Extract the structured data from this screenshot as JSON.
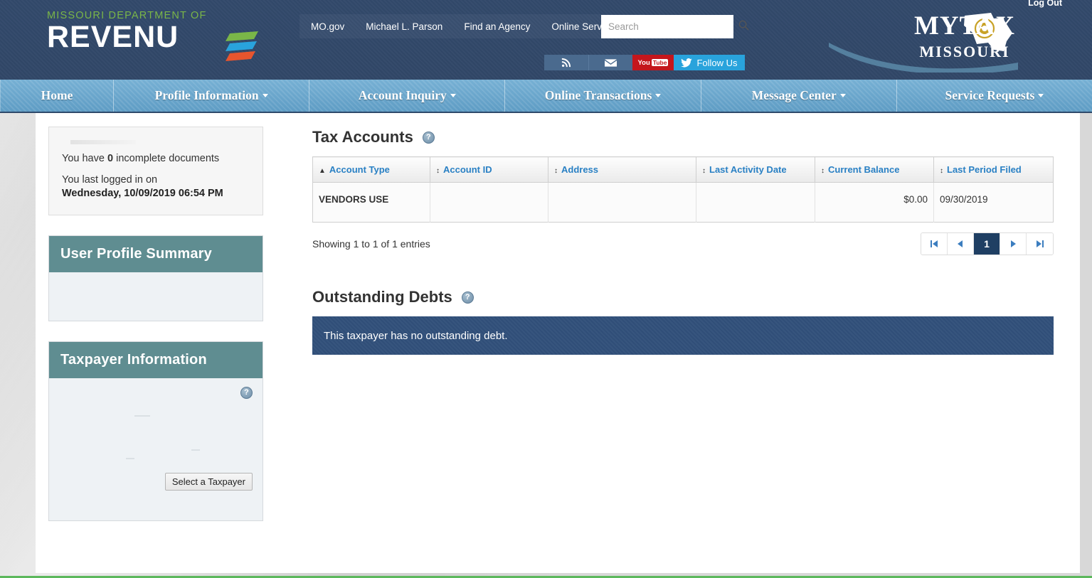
{
  "header": {
    "dor_logo_line1": "MISSOURI DEPARTMENT OF",
    "dor_logo_line2": "REVENU",
    "top_links": [
      {
        "label": "MO.gov"
      },
      {
        "label": "Michael L. Parson"
      },
      {
        "label": "Find an Agency"
      },
      {
        "label": "Online Services"
      }
    ],
    "search": {
      "placeholder": "Search",
      "value": ""
    },
    "social": [
      {
        "name": "rss",
        "label": ""
      },
      {
        "name": "email",
        "label": ""
      },
      {
        "name": "youtube",
        "label": "You",
        "badge": "Tube"
      },
      {
        "name": "twitter",
        "label": "Follow Us"
      }
    ],
    "brand_line1": "MYTAX",
    "brand_line2": "MISSOURI",
    "logout_label": "Log Out"
  },
  "mainnav": [
    {
      "label": "Home",
      "has_caret": false
    },
    {
      "label": "Profile Information",
      "has_caret": true
    },
    {
      "label": "Account Inquiry",
      "has_caret": true
    },
    {
      "label": "Online Transactions",
      "has_caret": true
    },
    {
      "label": "Message Center",
      "has_caret": true
    },
    {
      "label": "Service Requests",
      "has_caret": true
    }
  ],
  "sidebar": {
    "documents": {
      "prefix": "You have",
      "count": "0",
      "suffix": "incomplete documents",
      "login_label": "You last logged in on",
      "login_value": "Wednesday, 10/09/2019 06:54 PM"
    },
    "user_profile_panel": {
      "title": "User Profile Summary"
    },
    "taxpayer_panel": {
      "title": "Taxpayer Information",
      "select_button": "Select a Taxpayer",
      "help_icon": "help-icon"
    }
  },
  "main": {
    "tax_accounts": {
      "title": "Tax Accounts",
      "help_icon": "help-icon",
      "columns": [
        {
          "label": "Account Type",
          "sort": "asc"
        },
        {
          "label": "Account ID",
          "sort": "none"
        },
        {
          "label": "Address",
          "sort": "none"
        },
        {
          "label": "Last Activity Date",
          "sort": "none"
        },
        {
          "label": "Current Balance",
          "sort": "none"
        },
        {
          "label": "Last Period Filed",
          "sort": "none"
        }
      ],
      "rows": [
        {
          "account_type": "VENDORS USE",
          "account_id": "",
          "address": "",
          "last_activity_date": "",
          "current_balance": "$0.00",
          "last_period_filed": "09/30/2019"
        }
      ],
      "showing": "Showing 1 to 1 of 1 entries",
      "pagination": {
        "first": "⏮",
        "prev": "❮",
        "pages": [
          "1"
        ],
        "next": "❯",
        "last": "⏭",
        "active_page": "1"
      }
    },
    "outstanding_debts": {
      "title": "Outstanding Debts",
      "help_icon": "help-icon",
      "message": "This taxpayer has no outstanding debt."
    }
  },
  "colors": {
    "header_navy": "#32496b",
    "nav_blue": "#6aa5cc",
    "panel_teal": "#5f8d91",
    "banner_navy": "#31507a",
    "link_blue": "#2980c4",
    "active_page": "#1f3f63",
    "accent_green": "#7ab648",
    "bottom_rule_green": "#5cb85c"
  }
}
